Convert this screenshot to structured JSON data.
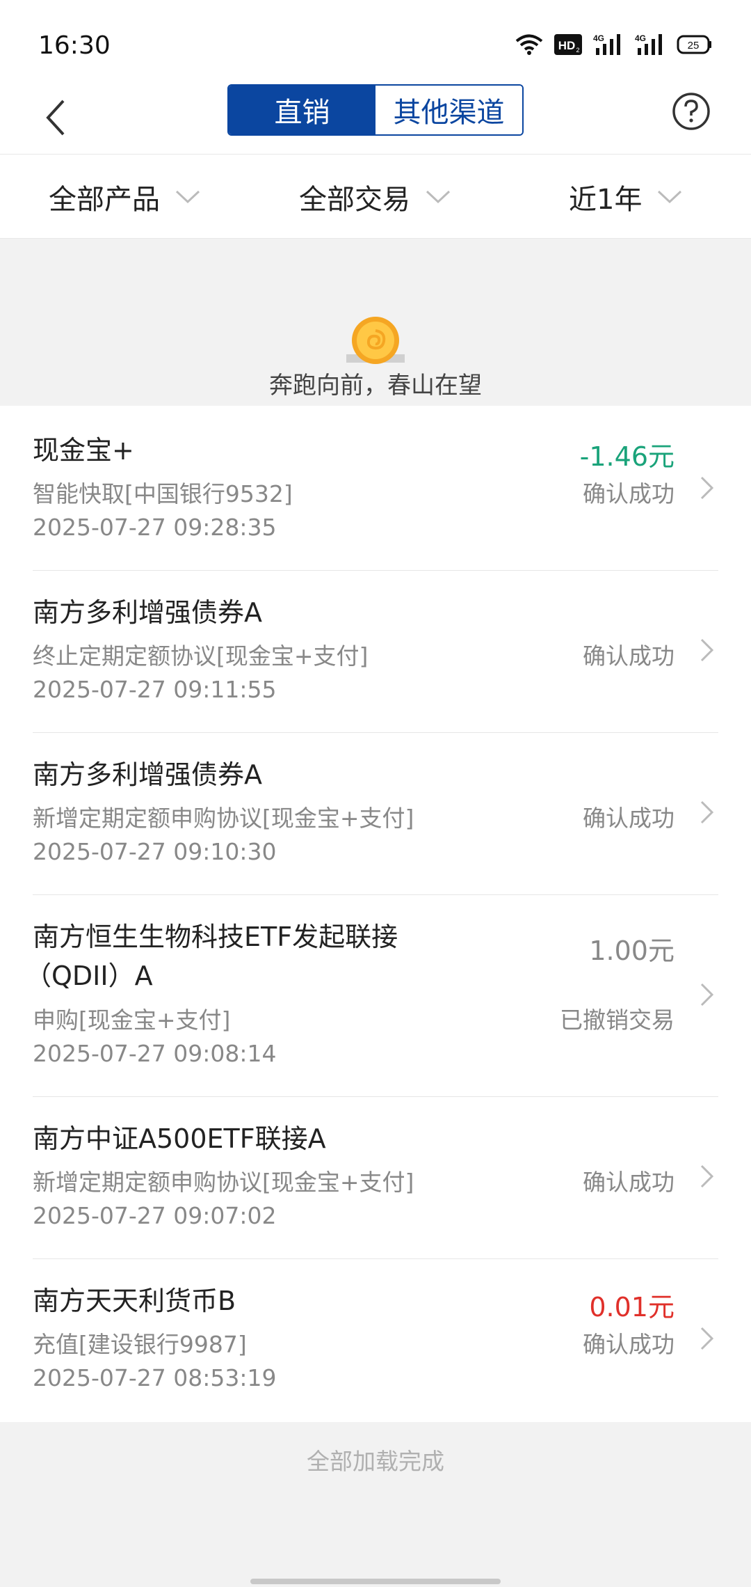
{
  "status": {
    "time": "16:30",
    "battery": "25",
    "hd_label": "HD",
    "net1": "4G",
    "net2": "4G"
  },
  "nav": {
    "tab_direct": "直销",
    "tab_other": "其他渠道"
  },
  "filters": {
    "product": "全部产品",
    "trade": "全部交易",
    "period": "近1年"
  },
  "banner": {
    "text": "奔跑向前，春山在望"
  },
  "records": [
    {
      "title": "现金宝+",
      "title2": "",
      "sub": "智能快取[中国银行9532]",
      "date": "2025-07-27 09:28:35",
      "amount": "-1.46元",
      "state": "确认成功"
    },
    {
      "title": "南方多利增强债券A",
      "title2": "",
      "sub": "终止定期定额协议[现金宝+支付]",
      "date": "2025-07-27 09:11:55",
      "amount": "",
      "state": "确认成功"
    },
    {
      "title": "南方多利增强债券A",
      "title2": "",
      "sub": "新增定期定额申购协议[现金宝+支付]",
      "date": "2025-07-27 09:10:30",
      "amount": "",
      "state": "确认成功"
    },
    {
      "title": "南方恒生生物科技ETF发起联接",
      "title2": "（QDII）A",
      "sub": "申购[现金宝+支付]",
      "date": "2025-07-27 09:08:14",
      "amount": "1.00元",
      "state": "已撤销交易"
    },
    {
      "title": "南方中证A500ETF联接A",
      "title2": "",
      "sub": "新增定期定额申购协议[现金宝+支付]",
      "date": "2025-07-27 09:07:02",
      "amount": "",
      "state": "确认成功"
    },
    {
      "title": "南方天天利货币B",
      "title2": "",
      "sub": "充值[建设银行9987]",
      "date": "2025-07-27 08:53:19",
      "amount": "0.01元",
      "state": "确认成功"
    }
  ],
  "footer": {
    "text": "全部加载完成"
  },
  "colors": {
    "brand": "#0b46a0",
    "amount_negative": "#1aa37a",
    "amount_positive": "#e0302a",
    "amount_neutral": "#888888"
  }
}
